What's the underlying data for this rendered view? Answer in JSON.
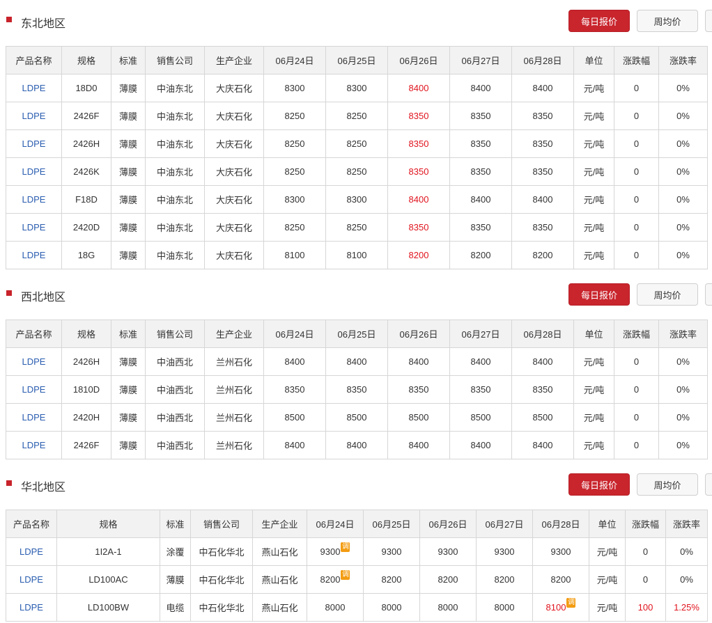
{
  "buttons": {
    "daily": "每日报价",
    "weekly": "周均价"
  },
  "adjust_badge": "调",
  "sections": [
    {
      "title": "东北地区",
      "headers": [
        "产品名称",
        "规格",
        "标准",
        "销售公司",
        "生产企业",
        "06月24日",
        "06月25日",
        "06月26日",
        "06月27日",
        "06月28日",
        "单位",
        "涨跌幅",
        "涨跌率"
      ],
      "rows": [
        {
          "cells": [
            "LDPE",
            "18D0",
            "薄膜",
            "中油东北",
            "大庆石化",
            "8300",
            "8300",
            "8400",
            "8400",
            "8400",
            "元/吨",
            "0",
            "0%"
          ]
        },
        {
          "cells": [
            "LDPE",
            "2426F",
            "薄膜",
            "中油东北",
            "大庆石化",
            "8250",
            "8250",
            "8350",
            "8350",
            "8350",
            "元/吨",
            "0",
            "0%"
          ]
        },
        {
          "cells": [
            "LDPE",
            "2426H",
            "薄膜",
            "中油东北",
            "大庆石化",
            "8250",
            "8250",
            "8350",
            "8350",
            "8350",
            "元/吨",
            "0",
            "0%"
          ]
        },
        {
          "cells": [
            "LDPE",
            "2426K",
            "薄膜",
            "中油东北",
            "大庆石化",
            "8250",
            "8250",
            "8350",
            "8350",
            "8350",
            "元/吨",
            "0",
            "0%"
          ]
        },
        {
          "cells": [
            "LDPE",
            "F18D",
            "薄膜",
            "中油东北",
            "大庆石化",
            "8300",
            "8300",
            "8400",
            "8400",
            "8400",
            "元/吨",
            "0",
            "0%"
          ]
        },
        {
          "cells": [
            "LDPE",
            "2420D",
            "薄膜",
            "中油东北",
            "大庆石化",
            "8250",
            "8250",
            "8350",
            "8350",
            "8350",
            "元/吨",
            "0",
            "0%"
          ]
        },
        {
          "cells": [
            "LDPE",
            "18G",
            "薄膜",
            "中油东北",
            "大庆石化",
            "8100",
            "8100",
            "8200",
            "8200",
            "8200",
            "元/吨",
            "0",
            "0%"
          ]
        }
      ]
    },
    {
      "title": "西北地区",
      "headers": [
        "产品名称",
        "规格",
        "标准",
        "销售公司",
        "生产企业",
        "06月24日",
        "06月25日",
        "06月26日",
        "06月27日",
        "06月28日",
        "单位",
        "涨跌幅",
        "涨跌率"
      ],
      "rows": [
        {
          "cells": [
            "LDPE",
            "2426H",
            "薄膜",
            "中油西北",
            "兰州石化",
            "8400",
            "8400",
            "8400",
            "8400",
            "8400",
            "元/吨",
            "0",
            "0%"
          ]
        },
        {
          "cells": [
            "LDPE",
            "1810D",
            "薄膜",
            "中油西北",
            "兰州石化",
            "8350",
            "8350",
            "8350",
            "8350",
            "8350",
            "元/吨",
            "0",
            "0%"
          ]
        },
        {
          "cells": [
            "LDPE",
            "2420H",
            "薄膜",
            "中油西北",
            "兰州石化",
            "8500",
            "8500",
            "8500",
            "8500",
            "8500",
            "元/吨",
            "0",
            "0%"
          ]
        },
        {
          "cells": [
            "LDPE",
            "2426F",
            "薄膜",
            "中油西北",
            "兰州石化",
            "8400",
            "8400",
            "8400",
            "8400",
            "8400",
            "元/吨",
            "0",
            "0%"
          ]
        }
      ]
    },
    {
      "title": "华北地区",
      "headers": [
        "产品名称",
        "规格",
        "标准",
        "销售公司",
        "生产企业",
        "06月24日",
        "06月25日",
        "06月26日",
        "06月27日",
        "06月28日",
        "单位",
        "涨跌幅",
        "涨跌率"
      ],
      "rows": [
        {
          "cells": [
            "LDPE",
            "1I2A-1",
            "涂覆",
            "中石化华北",
            "燕山石化",
            "9300",
            "9300",
            "9300",
            "9300",
            "9300",
            "元/吨",
            "0",
            "0%"
          ]
        },
        {
          "cells": [
            "LDPE",
            "LD100AC",
            "薄膜",
            "中石化华北",
            "燕山石化",
            "8200",
            "8200",
            "8200",
            "8200",
            "8200",
            "元/吨",
            "0",
            "0%"
          ]
        },
        {
          "cells": [
            "LDPE",
            "LD100BW",
            "电缆",
            "中石化华北",
            "燕山石化",
            "8000",
            "8000",
            "8000",
            "8000",
            "8100",
            "元/吨",
            "100",
            "1.25%"
          ]
        }
      ]
    }
  ]
}
